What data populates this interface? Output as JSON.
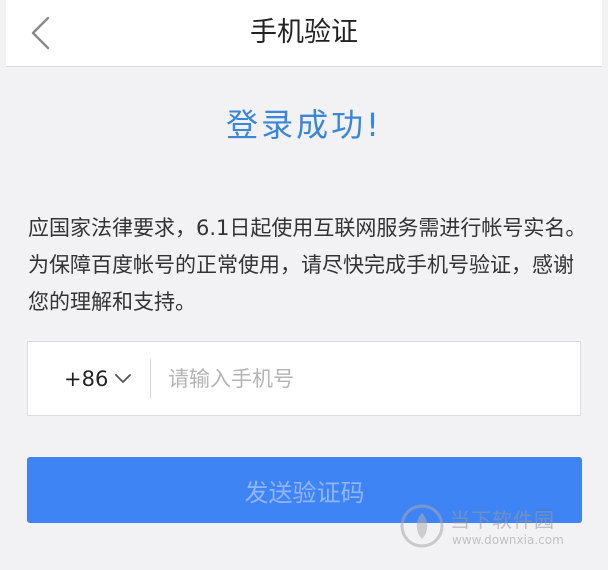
{
  "header": {
    "title": "手机验证",
    "back_icon": "chevron-left-icon"
  },
  "main": {
    "success_title": "登录成功!",
    "notice": "应国家法律要求，6.1日起使用互联网服务需进行帐号实名。为保障百度帐号的正常使用，请尽快完成手机号验证，感谢您的理解和支持。",
    "phone_field": {
      "country_code": "+86",
      "dropdown_icon": "chevron-down-icon",
      "value": "",
      "placeholder": "请输入手机号"
    },
    "send_button_label": "发送验证码"
  },
  "watermark": {
    "text": "当下软件园",
    "url": "www.downxia.com"
  },
  "colors": {
    "accent": "#3b86d6",
    "button": "#3f84f5",
    "button_text": "#8fb6f8",
    "background": "#f2f2f4"
  }
}
